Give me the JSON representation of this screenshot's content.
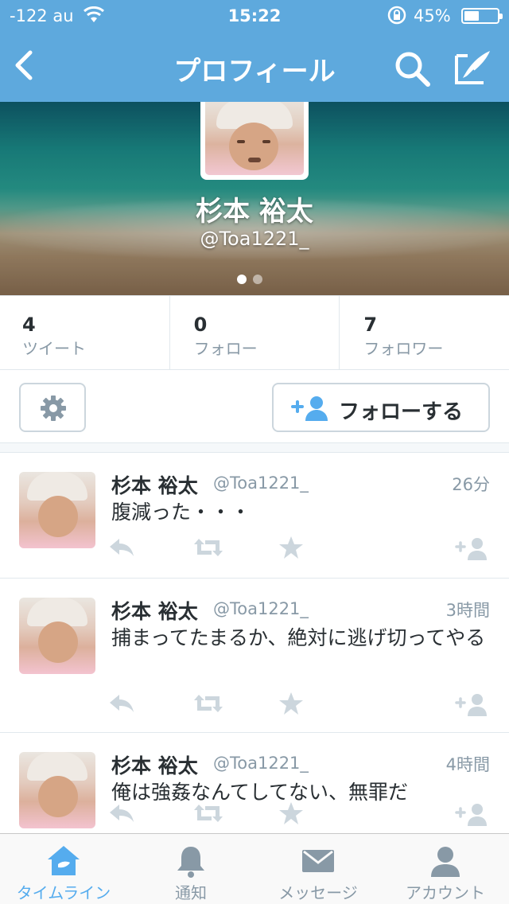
{
  "status_bar": {
    "carrier": "-122 au",
    "time": "15:22",
    "battery_percent": "45%",
    "battery_level": 0.45
  },
  "nav": {
    "title": "プロフィール",
    "back_icon": "chevron-left-icon",
    "search_icon": "search-icon",
    "compose_icon": "compose-icon"
  },
  "profile": {
    "name": "杉本 裕太",
    "handle": "@Toa1221_",
    "page_dots": 2,
    "active_dot": 1
  },
  "stats": [
    {
      "value": "4",
      "label": "ツイート"
    },
    {
      "value": "0",
      "label": "フォロー"
    },
    {
      "value": "7",
      "label": "フォロワー"
    }
  ],
  "actions": {
    "settings_icon": "gear-icon",
    "follow_label": "フォローする"
  },
  "tweets": [
    {
      "name": "杉本 裕太",
      "handle": "@Toa1221_",
      "time": "26分",
      "text": "腹減った・・・"
    },
    {
      "name": "杉本 裕太",
      "handle": "@Toa1221_",
      "time": "3時間",
      "text": "捕まってたまるか、絶対に逃げ切ってやる"
    },
    {
      "name": "杉本 裕太",
      "handle": "@Toa1221_",
      "time": "4時間",
      "text": "俺は強姦なんてしてない、無罪だ"
    }
  ],
  "tabbar": [
    {
      "label": "タイムライン",
      "icon": "home-icon",
      "active": true
    },
    {
      "label": "通知",
      "icon": "bell-icon",
      "active": false
    },
    {
      "label": "メッセージ",
      "icon": "envelope-icon",
      "active": false
    },
    {
      "label": "アカウント",
      "icon": "person-icon",
      "active": false
    }
  ],
  "colors": {
    "brand": "#5ea9dd",
    "active_tab": "#55acee",
    "action_icon": "#ccd6dd",
    "secondary_text": "#8899a6"
  }
}
